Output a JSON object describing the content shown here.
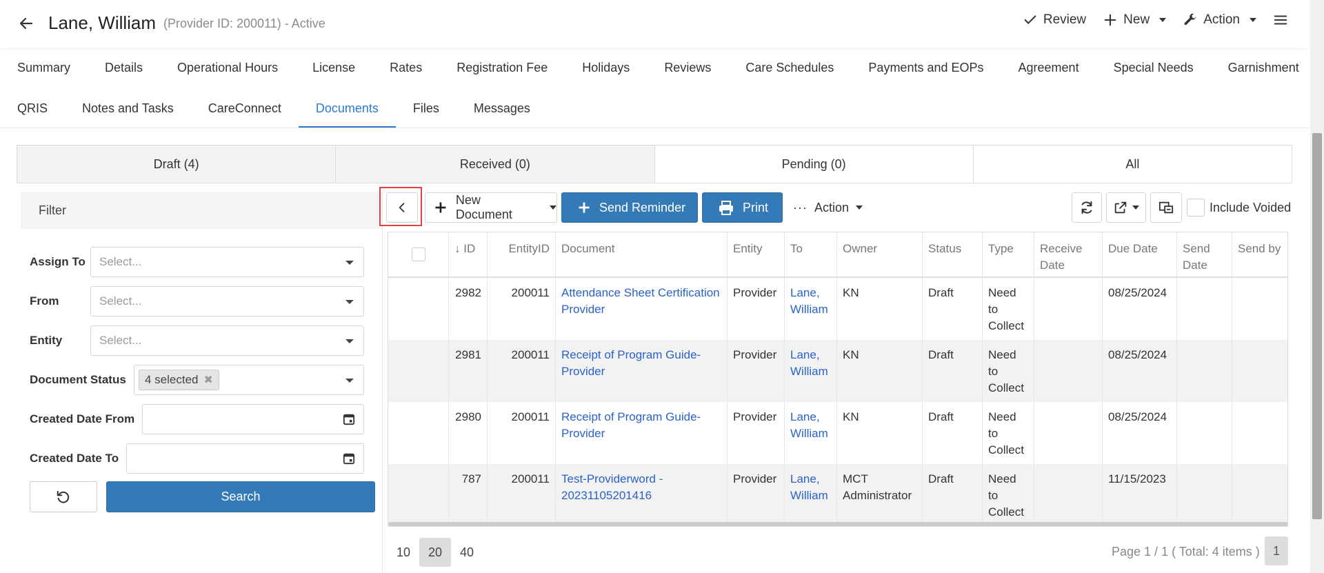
{
  "header": {
    "name": "Lane, William",
    "subtitle": "(Provider ID: 200011) - Active",
    "review_label": "Review",
    "new_label": "New",
    "action_label": "Action"
  },
  "nav": {
    "row1": [
      "Summary",
      "Details",
      "Operational Hours",
      "License",
      "Rates",
      "Registration Fee",
      "Holidays",
      "Reviews",
      "Care Schedules",
      "Payments and EOPs",
      "Agreement",
      "Special Needs",
      "Garnishment"
    ],
    "row2": [
      "QRIS",
      "Notes and Tasks",
      "CareConnect",
      "Documents",
      "Files",
      "Messages"
    ],
    "active": "Documents"
  },
  "status_tabs": [
    "Draft (4)",
    "Received (0)",
    "Pending (0)",
    "All"
  ],
  "filter": {
    "title": "Filter",
    "assign_to_label": "Assign To",
    "from_label": "From",
    "entity_label": "Entity",
    "document_status_label": "Document Status",
    "created_from_label": "Created Date From",
    "created_to_label": "Created Date To",
    "select_placeholder": "Select...",
    "status_chip": "4 selected",
    "search_label": "Search"
  },
  "toolbar": {
    "new_document_label": "New Document",
    "send_reminder_label": "Send Reminder",
    "print_label": "Print",
    "action_label": "Action",
    "include_voided_label": "Include Voided"
  },
  "table": {
    "headers": [
      "ID",
      "EntityID",
      "Document",
      "Entity",
      "To",
      "Owner",
      "Status",
      "Type",
      "Receive Date",
      "Due Date",
      "Send Date",
      "Send by"
    ],
    "rows": [
      {
        "id": "2982",
        "entity_id": "200011",
        "document": "Attendance Sheet Certification Provider",
        "entity": "Provider",
        "to": "Lane, William",
        "owner": "KN",
        "status": "Draft",
        "type": "Need to Collect",
        "receive_date": "",
        "due_date": "08/25/2024",
        "send_date": "",
        "send_by": ""
      },
      {
        "id": "2981",
        "entity_id": "200011",
        "document": "Receipt of Program Guide-Provider",
        "entity": "Provider",
        "to": "Lane, William",
        "owner": "KN",
        "status": "Draft",
        "type": "Need to Collect",
        "receive_date": "",
        "due_date": "08/25/2024",
        "send_date": "",
        "send_by": ""
      },
      {
        "id": "2980",
        "entity_id": "200011",
        "document": "Receipt of Program Guide-Provider",
        "entity": "Provider",
        "to": "Lane, William",
        "owner": "KN",
        "status": "Draft",
        "type": "Need to Collect",
        "receive_date": "",
        "due_date": "08/25/2024",
        "send_date": "",
        "send_by": ""
      },
      {
        "id": "787",
        "entity_id": "200011",
        "document": "Test-Providerword - 20231105201416",
        "entity": "Provider",
        "to": "Lane, William",
        "owner": "MCT Administrator",
        "status": "Draft",
        "type": "Need to Collect",
        "receive_date": "",
        "due_date": "11/15/2023",
        "send_date": "",
        "send_by": ""
      }
    ]
  },
  "pager": {
    "sizes": [
      "10",
      "20",
      "40"
    ],
    "active_size": "20",
    "info": "Page 1 / 1 ( Total: 4 items )",
    "current_page": "1"
  }
}
